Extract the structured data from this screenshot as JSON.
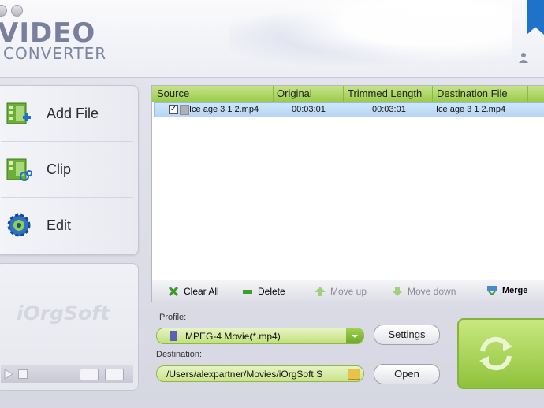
{
  "app": {
    "logo_line1": "VIDEO",
    "logo_line2": "CONVERTER",
    "brand": "iOrgSoft"
  },
  "sidebar": {
    "items": [
      {
        "label": "Add File",
        "icon": "add-file-icon"
      },
      {
        "label": "Clip",
        "icon": "clip-icon"
      },
      {
        "label": "Edit",
        "icon": "edit-gear-icon"
      }
    ]
  },
  "file_list": {
    "columns": [
      "Source",
      "Original",
      "Trimmed Length",
      "Destination File"
    ],
    "rows": [
      {
        "checked": true,
        "source": "Ice age 3 1 2.mp4",
        "original": "00:03:01",
        "trimmed": "00:03:01",
        "destination": "Ice age 3 1 2.mp4"
      }
    ]
  },
  "toolbar": {
    "clear_all": "Clear All",
    "delete": "Delete",
    "move_up": "Move up",
    "move_down": "Move down",
    "merge": "Merge"
  },
  "profile": {
    "label": "Profile:",
    "value": "MPEG-4 Movie(*.mp4)",
    "settings_button": "Settings"
  },
  "destination": {
    "label": "Destination:",
    "value": "/Users/alexpartner/Movies/iOrgSoft S",
    "open_button": "Open"
  },
  "colors": {
    "accent_green": "#9ccb4a",
    "selection_blue": "#b6d6f3",
    "ribbon_blue": "#1e72c8"
  }
}
